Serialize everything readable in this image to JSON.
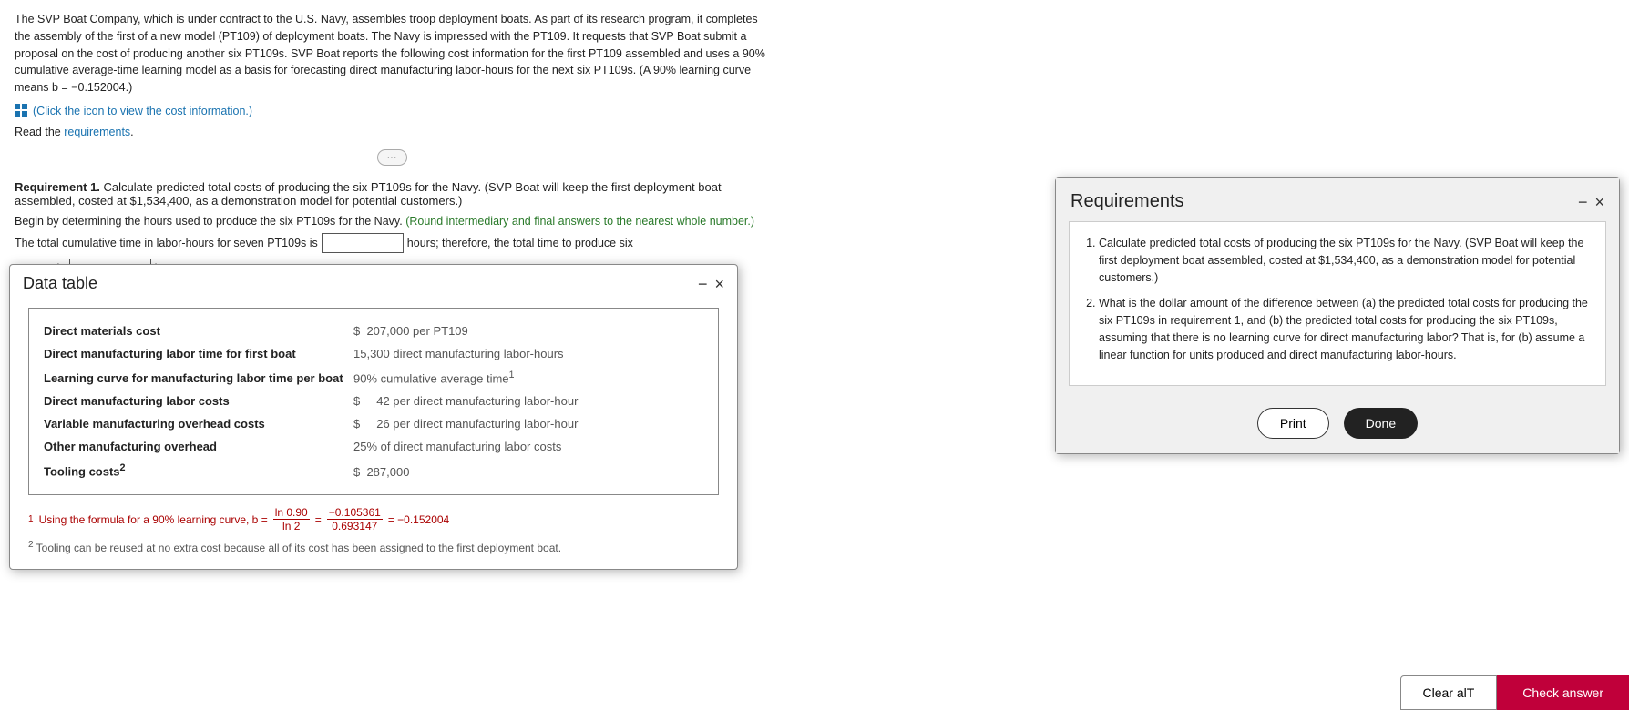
{
  "intro": {
    "text": "The SVP Boat Company, which is under contract to the U.S. Navy, assembles troop deployment boats. As part of its research program, it completes the assembly of the first of a new model (PT109) of deployment boats. The Navy is impressed with the PT109. It requests that SVP Boat submit a proposal on the cost of producing another six PT109s. SVP Boat reports the following cost information for the first PT109 assembled and uses a 90% cumulative average-time learning model as a basis for forecasting direct manufacturing labor-hours for the next six PT109s. (A 90% learning curve means b = −0.152004.)",
    "icon_hint": "Click the icon to view the cost information.",
    "read_label": "Read the",
    "requirements_link": "requirements",
    "read_end": "."
  },
  "divider": {
    "btn_label": "···"
  },
  "requirement1": {
    "heading_bold": "Requirement 1.",
    "heading_text": " Calculate predicted total costs of producing the six PT109s for the Navy. (SVP Boat will keep the first deployment boat assembled, costed at $1,534,400, as a demonstration model for potential customers.)",
    "begin_text": "Begin by determining the hours used to produce the six PT109s for the Navy.",
    "round_note": "(Round intermediary and final answers to the nearest whole number.)",
    "inline1_before": "The total cumulative time in labor-hours for seven PT109s is",
    "inline1_after": "hours; therefore, the total time to produce six",
    "inline2_before": "PT109s is",
    "inline2_after": "hours."
  },
  "data_table": {
    "title": "Data table",
    "minimize_label": "−",
    "close_label": "×",
    "rows": [
      {
        "label": "Direct materials cost",
        "value": "$  207,000 per PT109"
      },
      {
        "label": "Direct manufacturing labor time for first boat",
        "value": "15,300 direct manufacturing labor-hours"
      },
      {
        "label": "Learning curve for manufacturing labor time per boat",
        "value": "90% cumulative average time¹"
      },
      {
        "label": "Direct manufacturing labor costs",
        "value": "$     42 per direct manufacturing labor-hour"
      },
      {
        "label": "Variable manufacturing overhead costs",
        "value": "$     26 per direct manufacturing labor-hour"
      },
      {
        "label": "Other manufacturing overhead",
        "value": "25% of direct manufacturing labor costs"
      },
      {
        "label": "Tooling costs²",
        "value": "$  287,000"
      }
    ],
    "footnote1_sup": "1",
    "footnote1_text": "Using the formula for a 90% learning curve, b =",
    "footnote1_fraction_num": "ln 0.90",
    "footnote1_fraction_den": "ln 2",
    "footnote1_equals1": "−0.105361",
    "footnote1_separator": "=",
    "footnote1_fraction2_num": "0.693147",
    "footnote1_result": "= −0.152004",
    "footnote2_sup": "2",
    "footnote2_text": "Tooling can be reused at no extra cost because all of its cost has been assigned to the first deployment boat."
  },
  "requirements_modal": {
    "title": "Requirements",
    "minimize_label": "−",
    "close_label": "×",
    "items": [
      {
        "text": "Calculate predicted total costs of producing the six PT109s for the Navy. (SVP Boat will keep the first deployment boat assembled, costed at $1,534,400, as a demonstration model for potential customers.)"
      },
      {
        "text": "What is the dollar amount of the difference between (a) the predicted total costs for producing the six PT109s in requirement 1, and (b) the predicted total costs for producing the six PT109s, assuming that there is no learning curve for direct manufacturing labor? That is, for (b) assume a linear function for units produced and direct manufacturing labor-hours."
      }
    ],
    "print_label": "Print",
    "done_label": "Done"
  },
  "bottom_bar": {
    "clear_all_label": "Clear alT",
    "check_answer_label": "Check answer"
  }
}
